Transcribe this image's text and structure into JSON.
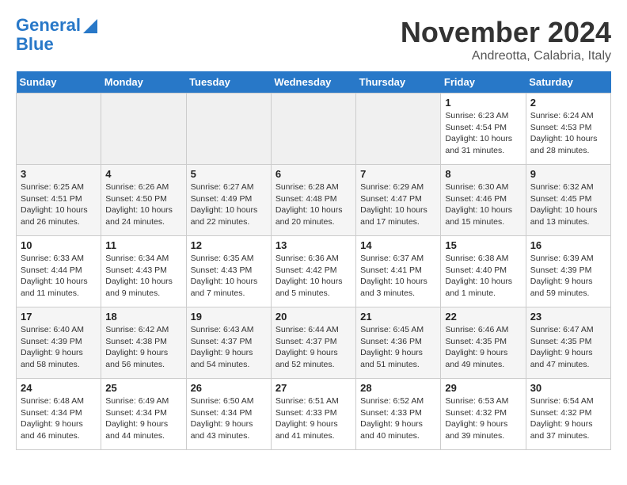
{
  "header": {
    "logo_line1": "General",
    "logo_line2": "Blue",
    "month_title": "November 2024",
    "location": "Andreotta, Calabria, Italy"
  },
  "days_of_week": [
    "Sunday",
    "Monday",
    "Tuesday",
    "Wednesday",
    "Thursday",
    "Friday",
    "Saturday"
  ],
  "weeks": [
    [
      {
        "day": "",
        "info": ""
      },
      {
        "day": "",
        "info": ""
      },
      {
        "day": "",
        "info": ""
      },
      {
        "day": "",
        "info": ""
      },
      {
        "day": "",
        "info": ""
      },
      {
        "day": "1",
        "info": "Sunrise: 6:23 AM\nSunset: 4:54 PM\nDaylight: 10 hours and 31 minutes."
      },
      {
        "day": "2",
        "info": "Sunrise: 6:24 AM\nSunset: 4:53 PM\nDaylight: 10 hours and 28 minutes."
      }
    ],
    [
      {
        "day": "3",
        "info": "Sunrise: 6:25 AM\nSunset: 4:51 PM\nDaylight: 10 hours and 26 minutes."
      },
      {
        "day": "4",
        "info": "Sunrise: 6:26 AM\nSunset: 4:50 PM\nDaylight: 10 hours and 24 minutes."
      },
      {
        "day": "5",
        "info": "Sunrise: 6:27 AM\nSunset: 4:49 PM\nDaylight: 10 hours and 22 minutes."
      },
      {
        "day": "6",
        "info": "Sunrise: 6:28 AM\nSunset: 4:48 PM\nDaylight: 10 hours and 20 minutes."
      },
      {
        "day": "7",
        "info": "Sunrise: 6:29 AM\nSunset: 4:47 PM\nDaylight: 10 hours and 17 minutes."
      },
      {
        "day": "8",
        "info": "Sunrise: 6:30 AM\nSunset: 4:46 PM\nDaylight: 10 hours and 15 minutes."
      },
      {
        "day": "9",
        "info": "Sunrise: 6:32 AM\nSunset: 4:45 PM\nDaylight: 10 hours and 13 minutes."
      }
    ],
    [
      {
        "day": "10",
        "info": "Sunrise: 6:33 AM\nSunset: 4:44 PM\nDaylight: 10 hours and 11 minutes."
      },
      {
        "day": "11",
        "info": "Sunrise: 6:34 AM\nSunset: 4:43 PM\nDaylight: 10 hours and 9 minutes."
      },
      {
        "day": "12",
        "info": "Sunrise: 6:35 AM\nSunset: 4:43 PM\nDaylight: 10 hours and 7 minutes."
      },
      {
        "day": "13",
        "info": "Sunrise: 6:36 AM\nSunset: 4:42 PM\nDaylight: 10 hours and 5 minutes."
      },
      {
        "day": "14",
        "info": "Sunrise: 6:37 AM\nSunset: 4:41 PM\nDaylight: 10 hours and 3 minutes."
      },
      {
        "day": "15",
        "info": "Sunrise: 6:38 AM\nSunset: 4:40 PM\nDaylight: 10 hours and 1 minute."
      },
      {
        "day": "16",
        "info": "Sunrise: 6:39 AM\nSunset: 4:39 PM\nDaylight: 9 hours and 59 minutes."
      }
    ],
    [
      {
        "day": "17",
        "info": "Sunrise: 6:40 AM\nSunset: 4:39 PM\nDaylight: 9 hours and 58 minutes."
      },
      {
        "day": "18",
        "info": "Sunrise: 6:42 AM\nSunset: 4:38 PM\nDaylight: 9 hours and 56 minutes."
      },
      {
        "day": "19",
        "info": "Sunrise: 6:43 AM\nSunset: 4:37 PM\nDaylight: 9 hours and 54 minutes."
      },
      {
        "day": "20",
        "info": "Sunrise: 6:44 AM\nSunset: 4:37 PM\nDaylight: 9 hours and 52 minutes."
      },
      {
        "day": "21",
        "info": "Sunrise: 6:45 AM\nSunset: 4:36 PM\nDaylight: 9 hours and 51 minutes."
      },
      {
        "day": "22",
        "info": "Sunrise: 6:46 AM\nSunset: 4:35 PM\nDaylight: 9 hours and 49 minutes."
      },
      {
        "day": "23",
        "info": "Sunrise: 6:47 AM\nSunset: 4:35 PM\nDaylight: 9 hours and 47 minutes."
      }
    ],
    [
      {
        "day": "24",
        "info": "Sunrise: 6:48 AM\nSunset: 4:34 PM\nDaylight: 9 hours and 46 minutes."
      },
      {
        "day": "25",
        "info": "Sunrise: 6:49 AM\nSunset: 4:34 PM\nDaylight: 9 hours and 44 minutes."
      },
      {
        "day": "26",
        "info": "Sunrise: 6:50 AM\nSunset: 4:34 PM\nDaylight: 9 hours and 43 minutes."
      },
      {
        "day": "27",
        "info": "Sunrise: 6:51 AM\nSunset: 4:33 PM\nDaylight: 9 hours and 41 minutes."
      },
      {
        "day": "28",
        "info": "Sunrise: 6:52 AM\nSunset: 4:33 PM\nDaylight: 9 hours and 40 minutes."
      },
      {
        "day": "29",
        "info": "Sunrise: 6:53 AM\nSunset: 4:32 PM\nDaylight: 9 hours and 39 minutes."
      },
      {
        "day": "30",
        "info": "Sunrise: 6:54 AM\nSunset: 4:32 PM\nDaylight: 9 hours and 37 minutes."
      }
    ]
  ]
}
